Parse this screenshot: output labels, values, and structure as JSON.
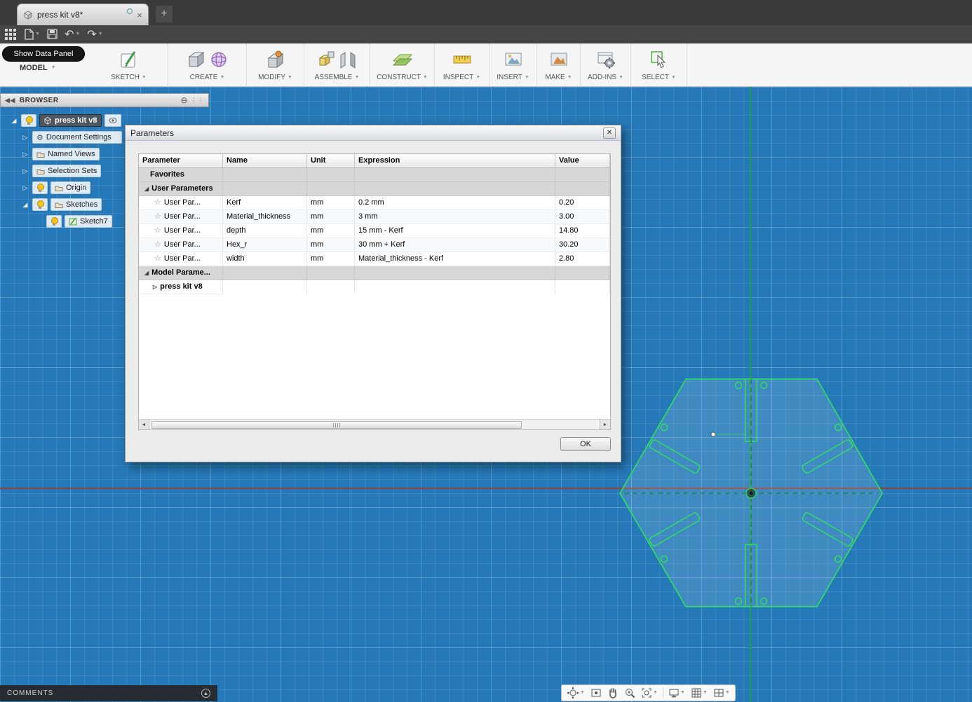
{
  "colors": {
    "canvas_blue": "#2679b8",
    "sketch_green": "#2ee35a",
    "centerline_green": "#157d2f",
    "axis_red": "#a93427",
    "toolbar_dark": "#3a3a3a"
  },
  "tabbar": {
    "tab_title": "press kit v8*"
  },
  "toolbar": {
    "show_data_panel": "Show Data Panel",
    "model_label": "MODEL",
    "groups": [
      {
        "label": "SKETCH"
      },
      {
        "label": "CREATE"
      },
      {
        "label": "MODIFY"
      },
      {
        "label": "ASSEMBLE"
      },
      {
        "label": "CONSTRUCT"
      },
      {
        "label": "INSPECT"
      },
      {
        "label": "INSERT"
      },
      {
        "label": "MAKE"
      },
      {
        "label": "ADD-INS"
      },
      {
        "label": "SELECT"
      }
    ]
  },
  "browser": {
    "title": "BROWSER",
    "root_label": "press kit v8",
    "items": [
      {
        "label": "Document Settings"
      },
      {
        "label": "Named Views"
      },
      {
        "label": "Selection Sets"
      },
      {
        "label": "Origin"
      },
      {
        "label": "Sketches"
      },
      {
        "label": "Sketch7"
      }
    ]
  },
  "dialog": {
    "title": "Parameters",
    "columns": [
      "Parameter",
      "Name",
      "Unit",
      "Expression",
      "Value"
    ],
    "favorites_label": "Favorites",
    "user_parameters_label": "User Parameters",
    "model_parameters_label": "Model Parame...",
    "model_child_label": "press kit v8",
    "rows": [
      {
        "parameter": "User Par...",
        "name": "Kerf",
        "unit": "mm",
        "expression": "0.2 mm",
        "value": "0.20"
      },
      {
        "parameter": "User Par...",
        "name": "Material_thickness",
        "unit": "mm",
        "expression": "3 mm",
        "value": "3.00"
      },
      {
        "parameter": "User Par...",
        "name": "depth",
        "unit": "mm",
        "expression": "15 mm - Kerf",
        "value": "14.80"
      },
      {
        "parameter": "User Par...",
        "name": "Hex_r",
        "unit": "mm",
        "expression": "30 mm + Kerf",
        "value": "30.20"
      },
      {
        "parameter": "User Par...",
        "name": "width",
        "unit": "mm",
        "expression": "Material_thickness - Kerf",
        "value": "2.80"
      }
    ],
    "ok_label": "OK"
  },
  "statusbar": {
    "comments_label": "COMMENTS"
  }
}
